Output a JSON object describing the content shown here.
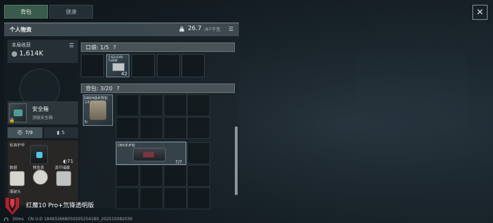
{
  "tabs": [
    {
      "label": "背包",
      "active": true
    },
    {
      "label": "健康",
      "active": false
    }
  ],
  "header": {
    "title": "个人物资",
    "weight_value": "26.7",
    "weight_max": "/87千克"
  },
  "earnings": {
    "label": "本局收获",
    "value": "1,614K"
  },
  "safe_box": {
    "title": "安全箱",
    "subtitle": "顶级安全箱"
  },
  "subtabs": [
    {
      "count": "7/9",
      "icon": "toolbox-icon"
    },
    {
      "count": "5",
      "icon": "canister-icon"
    }
  ],
  "gear": {
    "armor_label": "标准护甲",
    "armor_durability": "71",
    "slot_labels": [
      "数据",
      "鳄鱼表",
      "调节储藏"
    ],
    "helmet_label": "爆破头"
  },
  "pocket": {
    "label": "口袋: 1/5",
    "help": "?",
    "ammo_label_line1": "7.62x54R",
    "ammo_label_line2": "T-46M",
    "ammo_count": "42"
  },
  "backpack": {
    "label": "背包: 3/20",
    "help": "?",
    "bag_name": "DASH战术背包",
    "bag_sub": "三级背包",
    "dek_label": "DEK手术包",
    "dek_durability": "?/?"
  },
  "footer": {
    "brand": "红魔10 Pro+氘锋透明版",
    "ping": "30ms",
    "uid": "CN U:D 1849326680502052541B0_202510082030"
  }
}
